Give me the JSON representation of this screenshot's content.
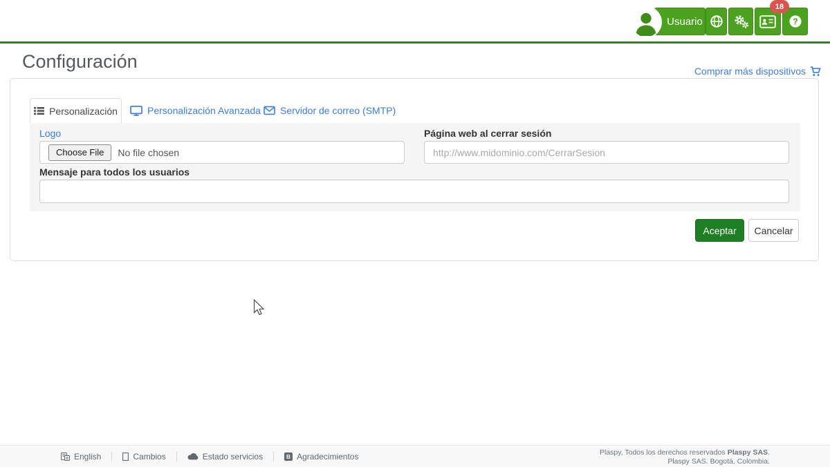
{
  "header": {
    "user_button": "Usuario",
    "notification_count": "18"
  },
  "page": {
    "title": "Configuración",
    "buy_devices_link": "Comprar más dispositivos"
  },
  "tabs": {
    "personalization": "Personalización",
    "advanced": "Personalización Avanzada",
    "smtp": "Servidor de correo (SMTP)"
  },
  "form": {
    "logo_label": "Logo",
    "file_button_label": "Choose File",
    "file_status": "No file chosen",
    "logout_url_label": "Página web al cerrar sesión",
    "logout_url_placeholder": "http://www.midominio.com/CerrarSesion",
    "message_label": "Mensaje para todos los usuarios",
    "message_value": "",
    "accept_button": "Aceptar",
    "cancel_button": "Cancelar"
  },
  "footer": {
    "links": {
      "language": "English",
      "changes": "Cambios",
      "status": "Estado servicios",
      "credits": "Agradecimientos"
    },
    "copyright_line1_prefix": "Plaspy, Todos los derechos reservados",
    "copyright_line1_company": "Plaspy SAS",
    "copyright_line1_suffix": ".",
    "copyright_line2": "Plaspy SAS. Bogotá, Colombia."
  },
  "colors": {
    "brand_green": "#4aa21e",
    "header_rule_green": "#36802a",
    "accept_green": "#1e7e23",
    "link_blue": "#3d7edd",
    "badge_red": "#d9534f",
    "pane_gray": "#f5f5f5"
  }
}
